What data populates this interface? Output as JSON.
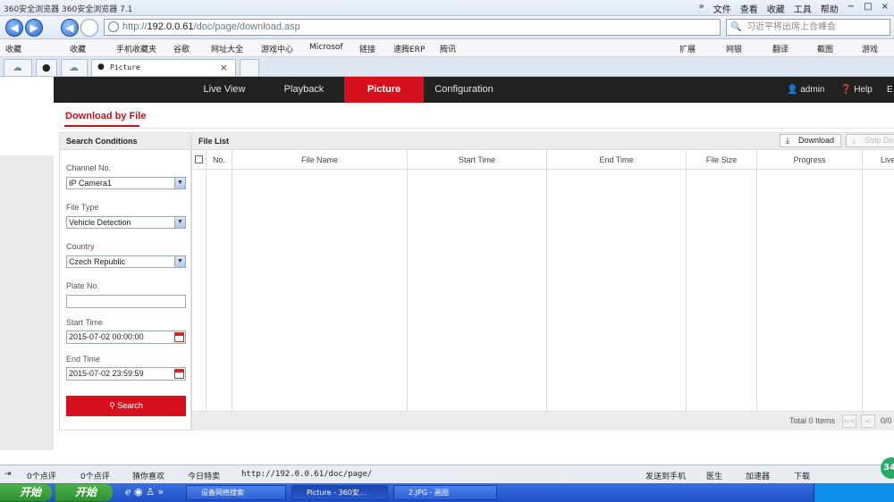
{
  "browser": {
    "title": "360安全浏览器  360安全浏览器 7.1",
    "menu": [
      "»",
      "文件",
      "查看",
      "收藏",
      "工具",
      "帮助"
    ],
    "window_buttons": [
      "−",
      "□",
      "×"
    ],
    "address": {
      "prefix": "http://",
      "host": "192.0.0.61",
      "path": "/doc/page/download.asp"
    },
    "search_placeholder": "习近平将出席上合峰会",
    "favorites": [
      "收藏",
      "收藏",
      "手机收藏夹",
      "谷歌",
      "网址大全",
      "游戏中心",
      "Microsof",
      "链接",
      "速腾ERP",
      "腾讯"
    ],
    "toolbar_right": [
      "扩展",
      "网银",
      "翻译",
      "截图",
      "游戏"
    ],
    "tabs": [
      {
        "label": "Picture",
        "close": "×"
      }
    ]
  },
  "app": {
    "menu": [
      {
        "label": "Live View"
      },
      {
        "label": "Playback"
      },
      {
        "label": "Picture"
      },
      {
        "label": "Configuration"
      }
    ],
    "user": "admin",
    "help": "Help",
    "logout_glyph": "E",
    "subtitle": "Download by File",
    "search": {
      "header": "Search Conditions",
      "channel_label": "Channel No.",
      "channel_value": "IP Camera1",
      "filetype_label": "File Type",
      "filetype_value": "Vehicle Detection",
      "country_label": "Country",
      "country_value": "Czech Republic",
      "plate_label": "Plate No.",
      "plate_value": "",
      "start_label": "Start Time",
      "start_value": "2015-07-02 00:00:00",
      "end_label": "End Time",
      "end_value": "2015-07-02 23:59:59",
      "search_button": "Search"
    },
    "file_list": {
      "header": "File List",
      "download_button": "Download",
      "stop_button": "Stop Do",
      "columns": [
        "No.",
        "File Name",
        "Start Time",
        "End Time",
        "File Size",
        "Progress",
        "Live"
      ],
      "total": "Total 0 Items",
      "page": "0/0"
    }
  },
  "statusbar": {
    "items": [
      "0个点评",
      "0个点评",
      "猜你喜欢",
      "今日特卖",
      "http://192.0.0.61/doc/page/",
      "发送到手机",
      "医生",
      "加速器",
      "下载"
    ],
    "badge": "34"
  },
  "taskbar": {
    "start1": "开始",
    "start2": "开始",
    "items": [
      "设备网络搜索",
      "Picture - 360安...",
      "2.JPG - 画图"
    ]
  },
  "colors": {
    "accent": "#d7101e",
    "header_bg": "#212121",
    "taskbar": "#2457d0"
  }
}
